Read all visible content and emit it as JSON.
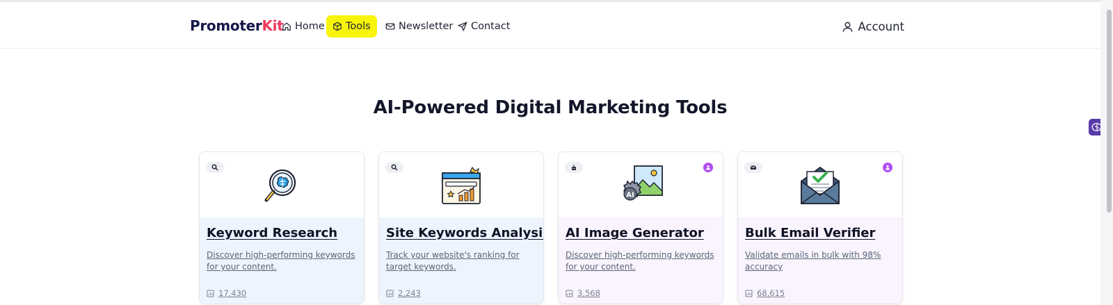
{
  "brand": {
    "part1": "Promoter",
    "part2": "Kit"
  },
  "nav": {
    "items": [
      {
        "label": "Home",
        "icon": "home-icon"
      },
      {
        "label": "Tools",
        "icon": "cube-icon",
        "highlight": "#f8f40a"
      },
      {
        "label": "Newsletter",
        "icon": "mail-icon"
      },
      {
        "label": "Contact",
        "icon": "send-icon"
      }
    ],
    "account": "Account"
  },
  "page_title": "AI-Powered Digital Marketing Tools",
  "colors": {
    "brand_dark": "#16184a",
    "brand_accent": "#ef3a5d",
    "premium": "#b14ef0",
    "card_blue": "#eef4fd",
    "card_purple": "#f9f4fe"
  },
  "tools": [
    {
      "title": "Keyword Research",
      "description": "Discover high-performing keywords for your content.",
      "count": "17,430",
      "category_icon": "search-icon",
      "image": "magnifier-brain-icon",
      "premium": false
    },
    {
      "title": "Site Keywords Analysis",
      "description": "Track your website's ranking for target keywords.",
      "count": "2,243",
      "category_icon": "search-icon",
      "image": "ranking-chart-icon",
      "premium": false
    },
    {
      "title": "AI Image Generator",
      "description": "Discover high-performing keywords for your content.",
      "count": "3,568",
      "category_icon": "robot-icon",
      "image": "ai-image-icon",
      "premium": true
    },
    {
      "title": "Bulk Email Verifier",
      "description": "Validate emails in bulk with 98% accuracy",
      "count": "68,615",
      "category_icon": "mail-icon",
      "image": "email-verified-icon",
      "premium": true
    }
  ]
}
